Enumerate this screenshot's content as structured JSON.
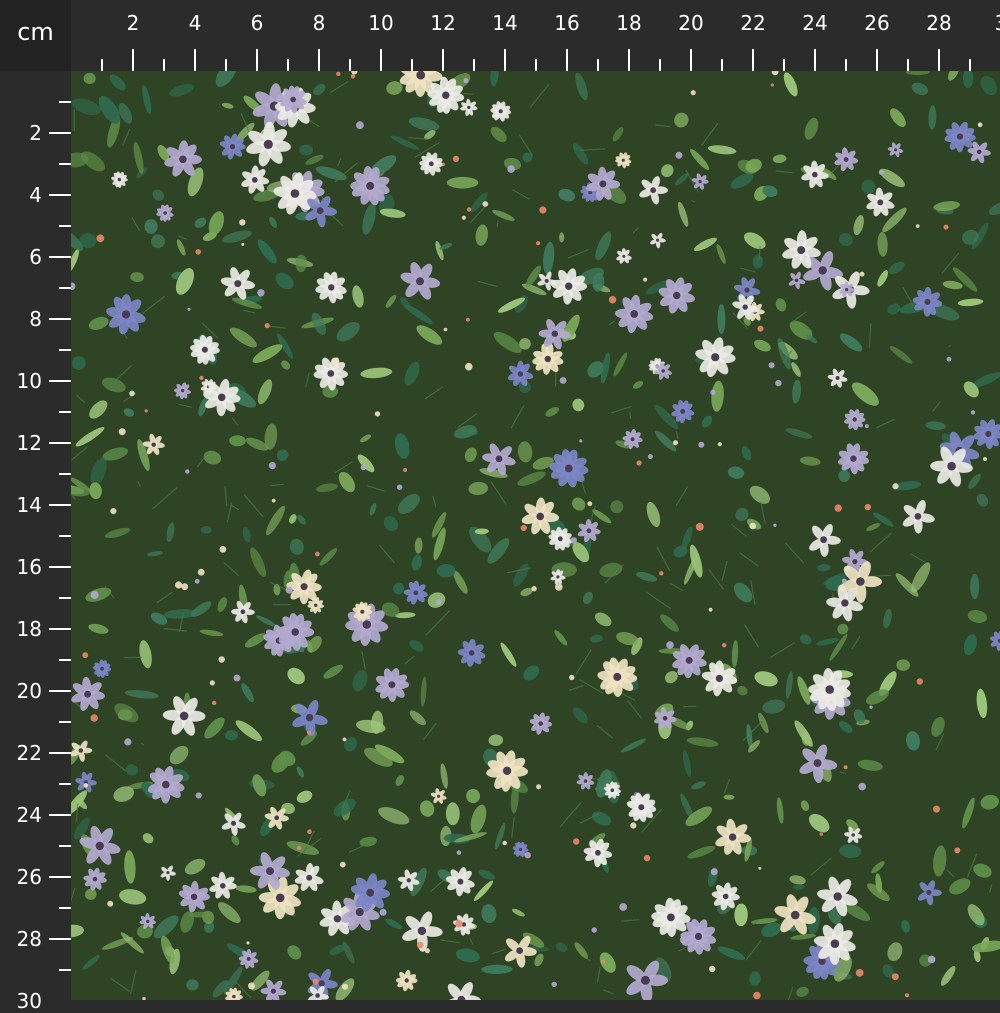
{
  "ruler": {
    "unit": "cm",
    "top_labels": [
      "2",
      "4",
      "6",
      "8",
      "10",
      "12",
      "14",
      "16",
      "18",
      "20",
      "22",
      "24",
      "26",
      "28",
      "3"
    ],
    "left_labels": [
      "2",
      "4",
      "6",
      "8",
      "10",
      "12",
      "14",
      "16",
      "18",
      "20",
      "22",
      "24",
      "26",
      "28",
      "30"
    ]
  },
  "fabric": {
    "background_color": "#2f4424",
    "palette": {
      "leaf_dark": "#2f6b4f",
      "leaf_mid": "#5f8f4a",
      "leaf_light": "#9bc47a",
      "petal_white": "#ecebe6",
      "petal_cream": "#efe3c2",
      "petal_lilac": "#b3a9cf",
      "petal_blue": "#7d86c6",
      "petal_coral": "#e98868",
      "center_dark": "#4a3d52"
    }
  }
}
